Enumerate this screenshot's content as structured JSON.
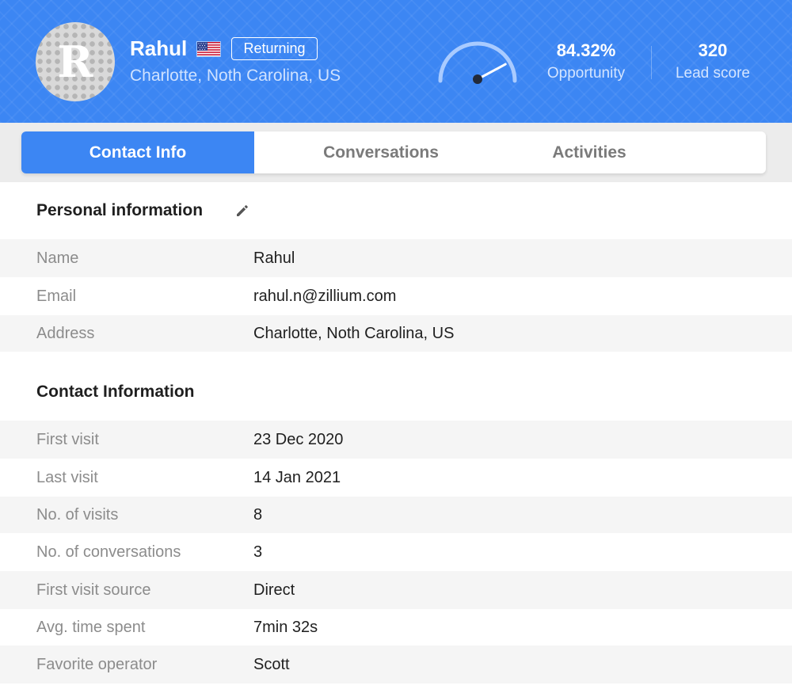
{
  "header": {
    "avatar_letter": "R",
    "name": "Rahul",
    "badge": "Returning",
    "location": "Charlotte, Noth Carolina, US",
    "flag_icon": "us-flag-icon",
    "opportunity_fraction": 0.8432,
    "opportunity_value": "84.32%",
    "opportunity_label": "Opportunity",
    "lead_score_value": "320",
    "lead_score_label": "Lead score"
  },
  "tabs": [
    {
      "label": "Contact Info",
      "active": true
    },
    {
      "label": "Conversations",
      "active": false
    },
    {
      "label": "Activities",
      "active": false
    }
  ],
  "personal": {
    "title": "Personal information",
    "edit_icon": "pencil-icon",
    "rows": [
      {
        "label": "Name",
        "value": "Rahul"
      },
      {
        "label": "Email",
        "value": "rahul.n@zillium.com"
      },
      {
        "label": "Address",
        "value": "Charlotte, Noth Carolina, US"
      }
    ]
  },
  "contact": {
    "title": "Contact Information",
    "rows": [
      {
        "label": "First visit",
        "value": "23 Dec 2020"
      },
      {
        "label": "Last visit",
        "value": "14 Jan 2021"
      },
      {
        "label": "No. of visits",
        "value": "8"
      },
      {
        "label": "No. of conversations",
        "value": "3"
      },
      {
        "label": "First visit source",
        "value": "Direct"
      },
      {
        "label": "Avg. time spent",
        "value": "7min 32s"
      },
      {
        "label": "Favorite operator",
        "value": "Scott"
      }
    ]
  },
  "colors": {
    "accent": "#3c86f3",
    "row_shade": "#f5f5f5",
    "label_text": "#8c8c8c",
    "value_text": "#1f1f1f"
  }
}
